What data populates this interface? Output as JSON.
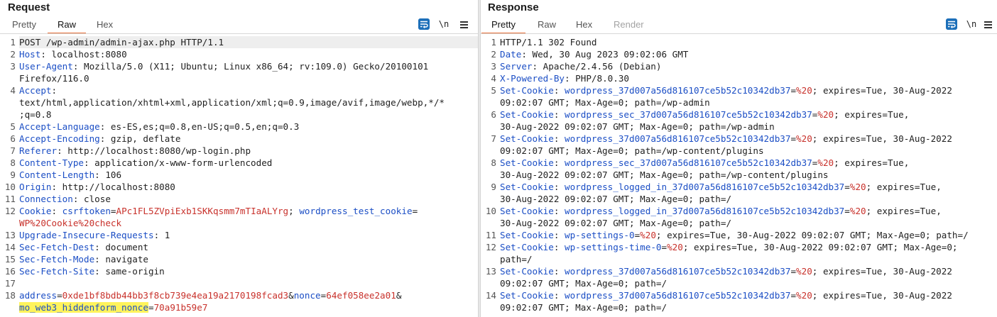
{
  "request": {
    "title": "Request",
    "tabs": [
      {
        "label": "Pretty"
      },
      {
        "label": "Raw",
        "active": true
      },
      {
        "label": "Hex"
      }
    ],
    "newline_label": "\\n",
    "lines": [
      {
        "num": "1",
        "parts": [
          {
            "t": "POST /wp-admin/admin-ajax.php HTTP/1.1"
          }
        ],
        "highlight": true
      },
      {
        "num": "2",
        "parts": [
          {
            "t": "Host",
            "c": "k"
          },
          {
            "t": ": localhost:8080"
          }
        ]
      },
      {
        "num": "3",
        "parts": [
          {
            "t": "User-Agent",
            "c": "k"
          },
          {
            "t": ": Mozilla/5.0 (X11; Ubuntu; Linux x86_64; rv:109.0) Gecko/20100101"
          }
        ]
      },
      {
        "num": "",
        "parts": [
          {
            "t": "Firefox/116.0"
          }
        ]
      },
      {
        "num": "4",
        "parts": [
          {
            "t": "Accept",
            "c": "k"
          },
          {
            "t": ":"
          }
        ]
      },
      {
        "num": "",
        "parts": [
          {
            "t": "text/html,application/xhtml+xml,application/xml;q=0.9,image/avif,image/webp,*/*"
          }
        ]
      },
      {
        "num": "",
        "parts": [
          {
            "t": ";q=0.8"
          }
        ]
      },
      {
        "num": "5",
        "parts": [
          {
            "t": "Accept-Language",
            "c": "k"
          },
          {
            "t": ": es-ES,es;q=0.8,en-US;q=0.5,en;q=0.3"
          }
        ]
      },
      {
        "num": "6",
        "parts": [
          {
            "t": "Accept-Encoding",
            "c": "k"
          },
          {
            "t": ": gzip, deflate"
          }
        ]
      },
      {
        "num": "7",
        "parts": [
          {
            "t": "Referer",
            "c": "k"
          },
          {
            "t": ": http://localhost:8080/wp-login.php"
          }
        ]
      },
      {
        "num": "8",
        "parts": [
          {
            "t": "Content-Type",
            "c": "k"
          },
          {
            "t": ": application/x-www-form-urlencoded"
          }
        ]
      },
      {
        "num": "9",
        "parts": [
          {
            "t": "Content-Length",
            "c": "k"
          },
          {
            "t": ": 106"
          }
        ]
      },
      {
        "num": "10",
        "parts": [
          {
            "t": "Origin",
            "c": "k"
          },
          {
            "t": ": http://localhost:8080"
          }
        ]
      },
      {
        "num": "11",
        "parts": [
          {
            "t": "Connection",
            "c": "k"
          },
          {
            "t": ": close"
          }
        ]
      },
      {
        "num": "12",
        "parts": [
          {
            "t": "Cookie",
            "c": "k"
          },
          {
            "t": ": "
          },
          {
            "t": "csrftoken",
            "c": "ck"
          },
          {
            "t": "="
          },
          {
            "t": "APc1FL5ZVpiExb1SKKqsmm7mTIaALYrg",
            "c": "cv"
          },
          {
            "t": "; "
          },
          {
            "t": "wordpress_test_cookie",
            "c": "ck"
          },
          {
            "t": "="
          }
        ]
      },
      {
        "num": "",
        "parts": [
          {
            "t": "WP%20Cookie%20check",
            "c": "cv"
          }
        ]
      },
      {
        "num": "13",
        "parts": [
          {
            "t": "Upgrade-Insecure-Requests",
            "c": "k"
          },
          {
            "t": ": 1"
          }
        ]
      },
      {
        "num": "14",
        "parts": [
          {
            "t": "Sec-Fetch-Dest",
            "c": "k"
          },
          {
            "t": ": document"
          }
        ]
      },
      {
        "num": "15",
        "parts": [
          {
            "t": "Sec-Fetch-Mode",
            "c": "k"
          },
          {
            "t": ": navigate"
          }
        ]
      },
      {
        "num": "16",
        "parts": [
          {
            "t": "Sec-Fetch-Site",
            "c": "k"
          },
          {
            "t": ": same-origin"
          }
        ]
      },
      {
        "num": "17",
        "parts": []
      },
      {
        "num": "18",
        "parts": [
          {
            "t": "address",
            "c": "ck"
          },
          {
            "t": "="
          },
          {
            "t": "0xde1bf8bdb44bb3f8cb739e4ea19a2170198fcad3",
            "c": "pv"
          },
          {
            "t": "&"
          },
          {
            "t": "nonce",
            "c": "ck"
          },
          {
            "t": "="
          },
          {
            "t": "64ef058ee2a01",
            "c": "pv"
          },
          {
            "t": "&"
          }
        ]
      },
      {
        "num": "",
        "parts": [
          {
            "t": "mo_web3_hiddenform_nonce",
            "c": "ck mark"
          },
          {
            "t": "="
          },
          {
            "t": "70a91b59e7",
            "c": "pv"
          }
        ]
      }
    ]
  },
  "response": {
    "title": "Response",
    "tabs": [
      {
        "label": "Pretty",
        "active": true
      },
      {
        "label": "Raw"
      },
      {
        "label": "Hex"
      },
      {
        "label": "Render",
        "disabled": true
      }
    ],
    "newline_label": "\\n",
    "lines": [
      {
        "num": "1",
        "parts": [
          {
            "t": "HTTP/1.1 302 Found"
          }
        ]
      },
      {
        "num": "2",
        "parts": [
          {
            "t": "Date",
            "c": "k"
          },
          {
            "t": ": Wed, 30 Aug 2023 09:02:06 GMT"
          }
        ]
      },
      {
        "num": "3",
        "parts": [
          {
            "t": "Server",
            "c": "k"
          },
          {
            "t": ": Apache/2.4.56 (Debian)"
          }
        ]
      },
      {
        "num": "4",
        "parts": [
          {
            "t": "X-Powered-By",
            "c": "k"
          },
          {
            "t": ": PHP/8.0.30"
          }
        ]
      },
      {
        "num": "5",
        "parts": [
          {
            "t": "Set-Cookie",
            "c": "k"
          },
          {
            "t": ": "
          },
          {
            "t": "wordpress_37d007a56d816107ce5b52c10342db37",
            "c": "ck"
          },
          {
            "t": "="
          },
          {
            "t": "%20",
            "c": "cv"
          },
          {
            "t": "; expires=Tue, 30-Aug-2022"
          }
        ]
      },
      {
        "num": "",
        "parts": [
          {
            "t": "09:02:07 GMT; Max-Age=0; path=/wp-admin"
          }
        ]
      },
      {
        "num": "6",
        "parts": [
          {
            "t": "Set-Cookie",
            "c": "k"
          },
          {
            "t": ": "
          },
          {
            "t": "wordpress_sec_37d007a56d816107ce5b52c10342db37",
            "c": "ck"
          },
          {
            "t": "="
          },
          {
            "t": "%20",
            "c": "cv"
          },
          {
            "t": "; expires=Tue,"
          }
        ]
      },
      {
        "num": "",
        "parts": [
          {
            "t": "30-Aug-2022 09:02:07 GMT; Max-Age=0; path=/wp-admin"
          }
        ]
      },
      {
        "num": "7",
        "parts": [
          {
            "t": "Set-Cookie",
            "c": "k"
          },
          {
            "t": ": "
          },
          {
            "t": "wordpress_37d007a56d816107ce5b52c10342db37",
            "c": "ck"
          },
          {
            "t": "="
          },
          {
            "t": "%20",
            "c": "cv"
          },
          {
            "t": "; expires=Tue, 30-Aug-2022"
          }
        ]
      },
      {
        "num": "",
        "parts": [
          {
            "t": "09:02:07 GMT; Max-Age=0; path=/wp-content/plugins"
          }
        ]
      },
      {
        "num": "8",
        "parts": [
          {
            "t": "Set-Cookie",
            "c": "k"
          },
          {
            "t": ": "
          },
          {
            "t": "wordpress_sec_37d007a56d816107ce5b52c10342db37",
            "c": "ck"
          },
          {
            "t": "="
          },
          {
            "t": "%20",
            "c": "cv"
          },
          {
            "t": "; expires=Tue,"
          }
        ]
      },
      {
        "num": "",
        "parts": [
          {
            "t": "30-Aug-2022 09:02:07 GMT; Max-Age=0; path=/wp-content/plugins"
          }
        ]
      },
      {
        "num": "9",
        "parts": [
          {
            "t": "Set-Cookie",
            "c": "k"
          },
          {
            "t": ": "
          },
          {
            "t": "wordpress_logged_in_37d007a56d816107ce5b52c10342db37",
            "c": "ck"
          },
          {
            "t": "="
          },
          {
            "t": "%20",
            "c": "cv"
          },
          {
            "t": "; expires=Tue,"
          }
        ]
      },
      {
        "num": "",
        "parts": [
          {
            "t": "30-Aug-2022 09:02:07 GMT; Max-Age=0; path=/"
          }
        ]
      },
      {
        "num": "10",
        "parts": [
          {
            "t": "Set-Cookie",
            "c": "k"
          },
          {
            "t": ": "
          },
          {
            "t": "wordpress_logged_in_37d007a56d816107ce5b52c10342db37",
            "c": "ck"
          },
          {
            "t": "="
          },
          {
            "t": "%20",
            "c": "cv"
          },
          {
            "t": "; expires=Tue,"
          }
        ]
      },
      {
        "num": "",
        "parts": [
          {
            "t": "30-Aug-2022 09:02:07 GMT; Max-Age=0; path=/"
          }
        ]
      },
      {
        "num": "11",
        "parts": [
          {
            "t": "Set-Cookie",
            "c": "k"
          },
          {
            "t": ": "
          },
          {
            "t": "wp-settings-0",
            "c": "ck"
          },
          {
            "t": "="
          },
          {
            "t": "%20",
            "c": "cv"
          },
          {
            "t": "; expires=Tue, 30-Aug-2022 09:02:07 GMT; Max-Age=0; path=/"
          }
        ]
      },
      {
        "num": "12",
        "parts": [
          {
            "t": "Set-Cookie",
            "c": "k"
          },
          {
            "t": ": "
          },
          {
            "t": "wp-settings-time-0",
            "c": "ck"
          },
          {
            "t": "="
          },
          {
            "t": "%20",
            "c": "cv"
          },
          {
            "t": "; expires=Tue, 30-Aug-2022 09:02:07 GMT; Max-Age=0;"
          }
        ]
      },
      {
        "num": "",
        "parts": [
          {
            "t": "path=/"
          }
        ]
      },
      {
        "num": "13",
        "parts": [
          {
            "t": "Set-Cookie",
            "c": "k"
          },
          {
            "t": ": "
          },
          {
            "t": "wordpress_37d007a56d816107ce5b52c10342db37",
            "c": "ck"
          },
          {
            "t": "="
          },
          {
            "t": "%20",
            "c": "cv"
          },
          {
            "t": "; expires=Tue, 30-Aug-2022"
          }
        ]
      },
      {
        "num": "",
        "parts": [
          {
            "t": "09:02:07 GMT; Max-Age=0; path=/"
          }
        ]
      },
      {
        "num": "14",
        "parts": [
          {
            "t": "Set-Cookie",
            "c": "k"
          },
          {
            "t": ": "
          },
          {
            "t": "wordpress_37d007a56d816107ce5b52c10342db37",
            "c": "ck"
          },
          {
            "t": "="
          },
          {
            "t": "%20",
            "c": "cv"
          },
          {
            "t": "; expires=Tue, 30-Aug-2022"
          }
        ]
      },
      {
        "num": "",
        "parts": [
          {
            "t": "09:02:07 GMT; Max-Age=0; path=/"
          }
        ]
      }
    ]
  },
  "colors": {
    "accent_tab": "#e8703a",
    "header_name": "#1b4ec5",
    "value": "#c8312b",
    "highlight": "#fff35c",
    "button_blue": "#1c6fb9"
  },
  "icons": [
    "wrap-lines-icon",
    "menu-icon",
    "layout-toggle-icon"
  ]
}
